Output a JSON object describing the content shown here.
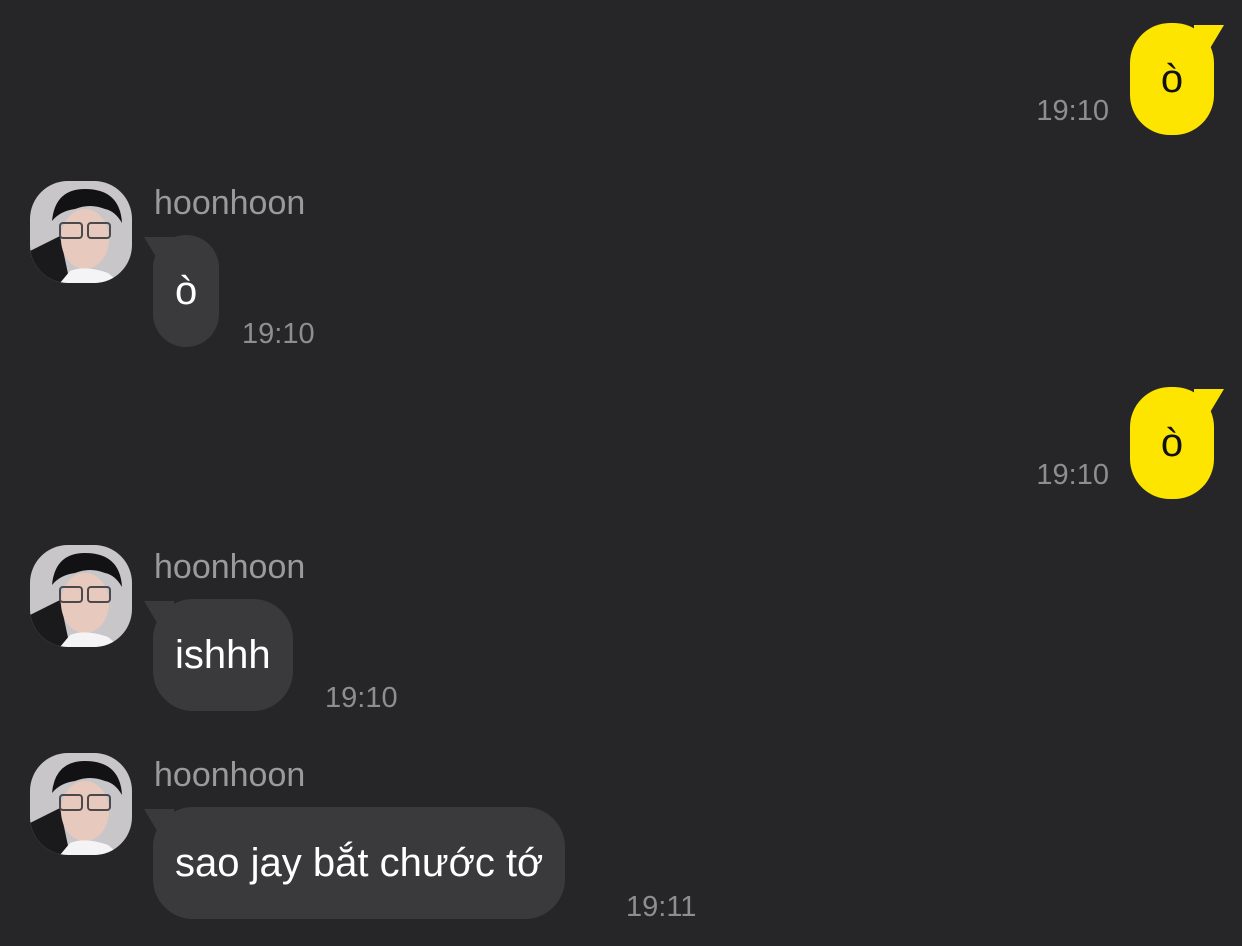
{
  "messages": [
    {
      "direction": "outgoing",
      "text": "ò",
      "time": "19:10"
    },
    {
      "direction": "incoming",
      "sender": "hoonhoon",
      "text": "ò",
      "time": "19:10"
    },
    {
      "direction": "outgoing",
      "text": "ò",
      "time": "19:10"
    },
    {
      "direction": "incoming",
      "sender": "hoonhoon",
      "text": "ishhh",
      "time": "19:10"
    },
    {
      "direction": "incoming",
      "sender": "hoonhoon",
      "text": "sao jay bắt chước tớ",
      "time": "19:11"
    }
  ],
  "colors": {
    "background": "#262628",
    "outgoing_bubble": "#fde500",
    "incoming_bubble": "#3a3a3c",
    "timestamp": "#8e8e90",
    "sender_name": "#9a9a9c"
  },
  "icons": {
    "avatar": "profile-photo"
  }
}
